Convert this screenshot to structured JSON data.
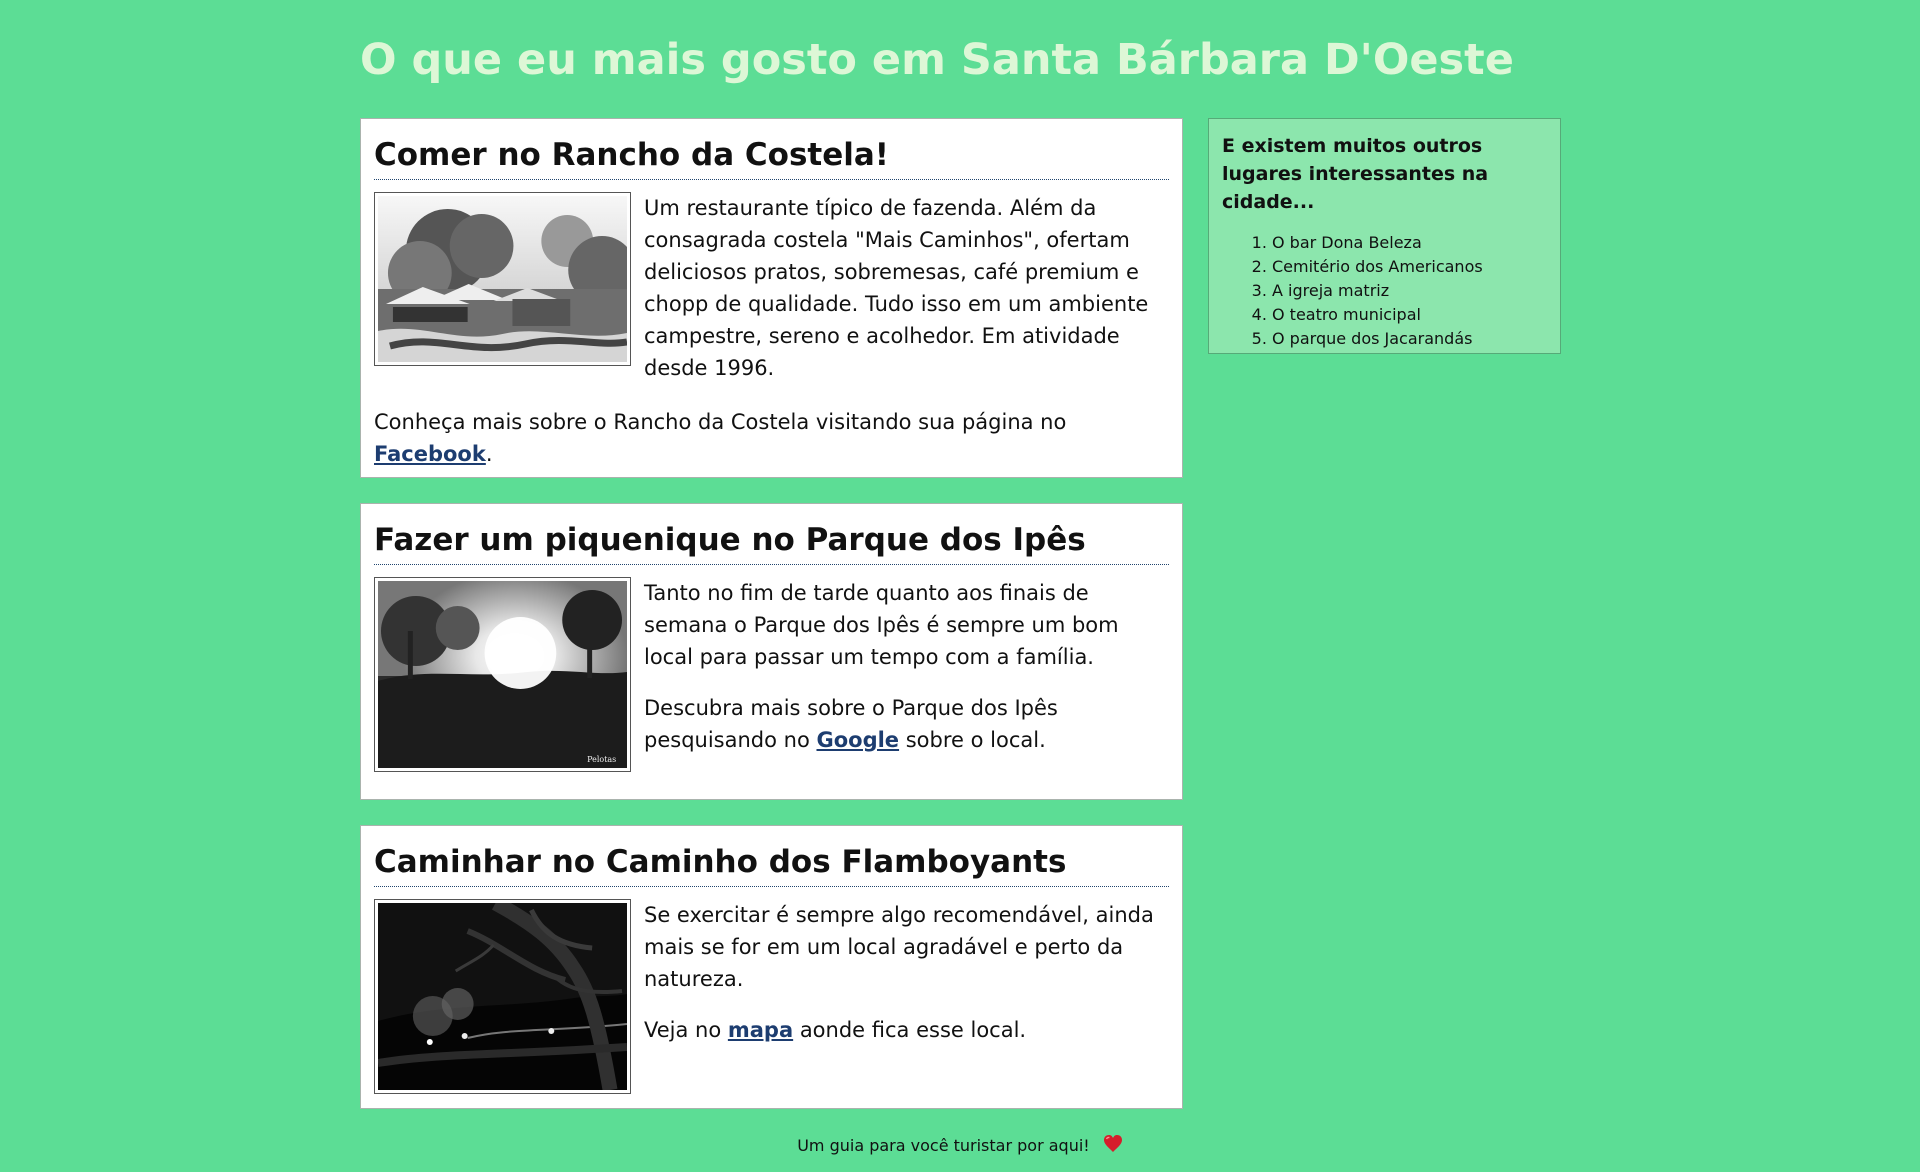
{
  "page": {
    "title": "O que eu mais gosto em Santa Bárbara D'Oeste"
  },
  "articles": [
    {
      "title": "Comer no Rancho da Costela!",
      "photo_icon": "restaurant-photo",
      "paragraphs": [
        {
          "text": "Um restaurante típico de fazenda. Além da consagrada costela \"Mais Caminhos\", ofertam deliciosos pratos, sobremesas, café premium e chopp de qualidade. Tudo isso em um ambiente campestre, sereno e acolhedor. Em atividade desde 1996."
        },
        {
          "before": "Conheça mais sobre o Rancho da Costela visitando sua página no ",
          "link": "Facebook",
          "after": "."
        }
      ]
    },
    {
      "title": "Fazer um piquenique no Parque dos Ipês",
      "photo_icon": "park-photo",
      "paragraphs": [
        {
          "text": "Tanto no fim de tarde quanto aos finais de semana o Parque dos Ipês é sempre um bom local para passar um tempo com a família."
        },
        {
          "before": "Descubra mais sobre o Parque dos Ipês pesquisando no ",
          "link": "Google",
          "after": " sobre o local."
        }
      ]
    },
    {
      "title": "Caminhar no Caminho dos Flamboyants",
      "photo_icon": "night-path-photo",
      "paragraphs": [
        {
          "text": "Se exercitar é sempre algo recomendável, ainda mais se for em um local agradável e perto da natureza."
        },
        {
          "before": "Veja no ",
          "link": "mapa",
          "after": " aonde fica esse local."
        }
      ]
    }
  ],
  "sidebar": {
    "title": "E existem muitos outros lugares interessantes na cidade...",
    "items": [
      "O bar Dona Beleza",
      "Cemitério dos Americanos",
      "A igreja matriz",
      "O teatro municipal",
      "O parque dos Jacarandás"
    ]
  },
  "footer": {
    "text": "Um guia para você turistar por aqui!",
    "icon": "heart-icon"
  },
  "colors": {
    "background": "#5cdd95",
    "title": "#ddf7d6",
    "sidebar_background": "#8ce6ad",
    "link": "#1d3d70"
  }
}
